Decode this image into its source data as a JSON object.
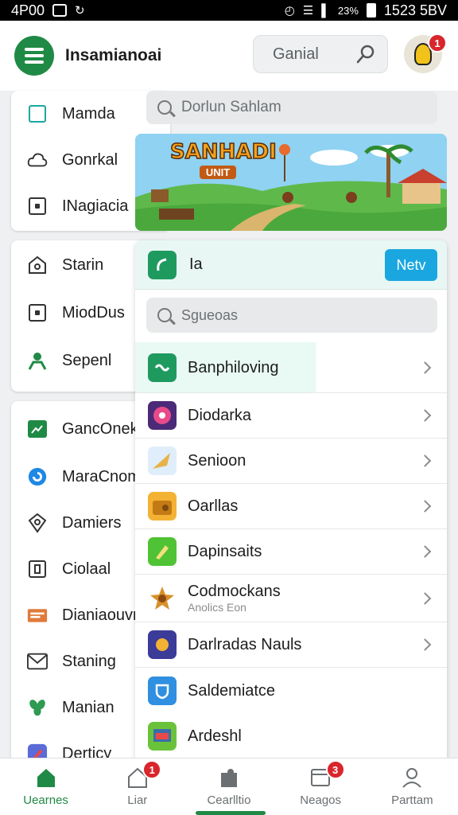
{
  "status_bar": {
    "time": "4P00",
    "right_text": "1523 5BV",
    "battery_text": "23%"
  },
  "header": {
    "title": "Insamianoai",
    "search_label": "Ganial",
    "avatar_badge": "1"
  },
  "top_search": {
    "placeholder": "Dorlun Sahlam"
  },
  "banner": {
    "title": "SANHADI",
    "subtitle": "UNIT"
  },
  "side_groups": [
    {
      "items": [
        {
          "label": "Mamda",
          "icon": "checkbox-icon"
        },
        {
          "label": "Gonrkal",
          "icon": "cloud-icon"
        },
        {
          "label": "INagiacia",
          "icon": "square-dot-icon"
        }
      ]
    },
    {
      "items": [
        {
          "label": "Starin",
          "icon": "home-icon"
        },
        {
          "label": "MiodDus",
          "icon": "square-dot-icon"
        },
        {
          "label": "Sepenl",
          "icon": "person-icon"
        }
      ]
    },
    {
      "items": [
        {
          "label": "GancOnek",
          "icon": "photo-icon"
        },
        {
          "label": "MaraCnom",
          "icon": "refresh-icon"
        },
        {
          "label": "Damiers",
          "icon": "shield-icon"
        },
        {
          "label": "Ciolaal",
          "icon": "document-icon"
        },
        {
          "label": "Dianiaouvn",
          "icon": "folder-icon"
        },
        {
          "label": "Staning",
          "icon": "mail-icon"
        },
        {
          "label": "Manian",
          "icon": "leaf-icon"
        },
        {
          "label": "Derticy",
          "icon": "pen-icon"
        }
      ]
    }
  ],
  "panel": {
    "top_label": "Ia",
    "new_button": "Netv",
    "search_placeholder": "Sgueoas",
    "rows": [
      {
        "label": "Banphiloving",
        "sub": ""
      },
      {
        "label": "Diodarka",
        "sub": ""
      },
      {
        "label": "Senioon",
        "sub": ""
      },
      {
        "label": "Oarllas",
        "sub": ""
      },
      {
        "label": "Dapinsaits",
        "sub": ""
      },
      {
        "label": "Codmockans",
        "sub": "Anolics Eon"
      },
      {
        "label": "Darlradas Nauls",
        "sub": ""
      },
      {
        "label": "Saldemiatce",
        "sub": ""
      },
      {
        "label": "Ardeshl",
        "sub": ""
      }
    ]
  },
  "bottom_nav": [
    {
      "label": "Uearnes",
      "badge": ""
    },
    {
      "label": "Liar",
      "badge": "1"
    },
    {
      "label": "Cearlltio",
      "badge": ""
    },
    {
      "label": "Neagos",
      "badge": "3"
    },
    {
      "label": "Parttam",
      "badge": ""
    }
  ],
  "colors": {
    "brand": "#1f8a45",
    "accent": "#1aa7e0",
    "badge": "#d8262c"
  }
}
